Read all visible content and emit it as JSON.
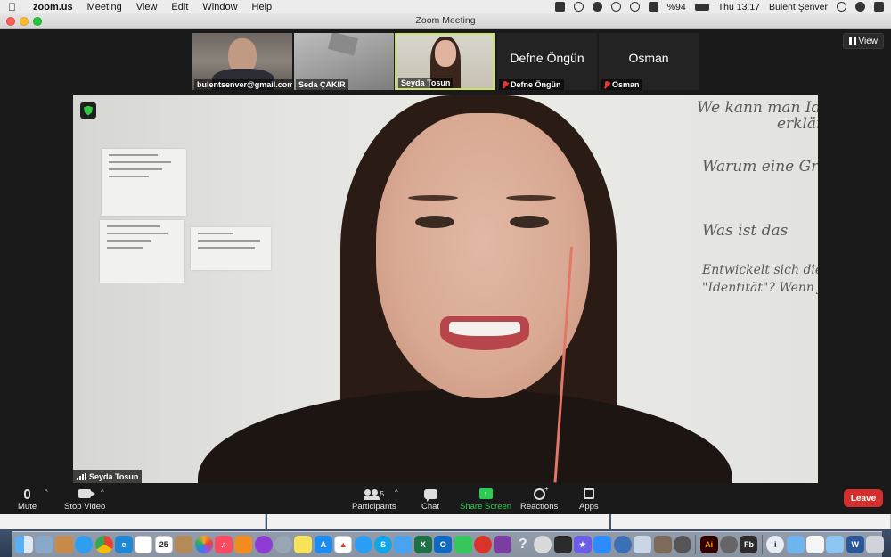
{
  "menubar": {
    "app_name": "zoom.us",
    "menus": [
      "Meeting",
      "View",
      "Edit",
      "Window",
      "Help"
    ],
    "battery": "%94",
    "clock": "Thu 13:17",
    "user": "Bülent Şenver"
  },
  "window": {
    "title": "Zoom Meeting"
  },
  "view_button": {
    "label": "View"
  },
  "thumbnails": [
    {
      "name": "bulentsenver@gmail.com",
      "muted": false,
      "video_on": true
    },
    {
      "name": "Seda ÇAKIR",
      "muted": false,
      "video_on": true
    },
    {
      "name": "Seyda Tosun",
      "muted": false,
      "video_on": true,
      "active_speaker": true
    },
    {
      "name": "Defne Öngün",
      "display_name": "Defne Öngün",
      "muted": true,
      "video_on": false
    },
    {
      "name": "Osman",
      "display_name": "Osman",
      "muted": true,
      "video_on": false
    }
  ],
  "main_video": {
    "speaker": "Seyda Tosun"
  },
  "whiteboard_text": [
    "We kann man Identität",
    "erklären",
    "Warum eine Gruppe",
    "Was ist das",
    "Entwickelt sich die",
    "\"Identität\"? Wenn ja"
  ],
  "toolbar": {
    "mute": "Mute",
    "stop_video": "Stop Video",
    "participants": "Participants",
    "participant_count": "5",
    "chat": "Chat",
    "share_screen": "Share Screen",
    "reactions": "Reactions",
    "apps": "Apps",
    "leave": "Leave"
  },
  "dock": {
    "calendar_day": "25",
    "icons": [
      "finder-icon",
      "preview-icon",
      "folder-icon",
      "safari-icon",
      "chrome-icon",
      "ie-icon",
      "notes-icon",
      "calendar-icon",
      "contacts-icon",
      "photos-icon",
      "music-icon",
      "books-icon",
      "podcasts-icon",
      "rocket-icon",
      "stickies-icon",
      "appstore-icon",
      "acrobat-icon",
      "messenger-icon",
      "skype-icon",
      "mail-icon",
      "excel-icon",
      "outlook-icon",
      "facetime-icon",
      "pdf-icon",
      "onenote-icon",
      "help-icon",
      "disk-icon",
      "terminal-icon",
      "imovie-icon",
      "zoom-icon",
      "search-icon",
      "preview2-icon",
      "trash-like-icon",
      "alfred-icon",
      "quicktime-icon",
      "illustrator-icon",
      "facebook-icon",
      "finder2-icon",
      "folder2-icon",
      "doc-icon",
      "screenshot-icon",
      "word-icon",
      "trash-icon"
    ],
    "labels": {
      "illustrator": "Ai",
      "facebook": "Fb",
      "word": "W"
    }
  }
}
